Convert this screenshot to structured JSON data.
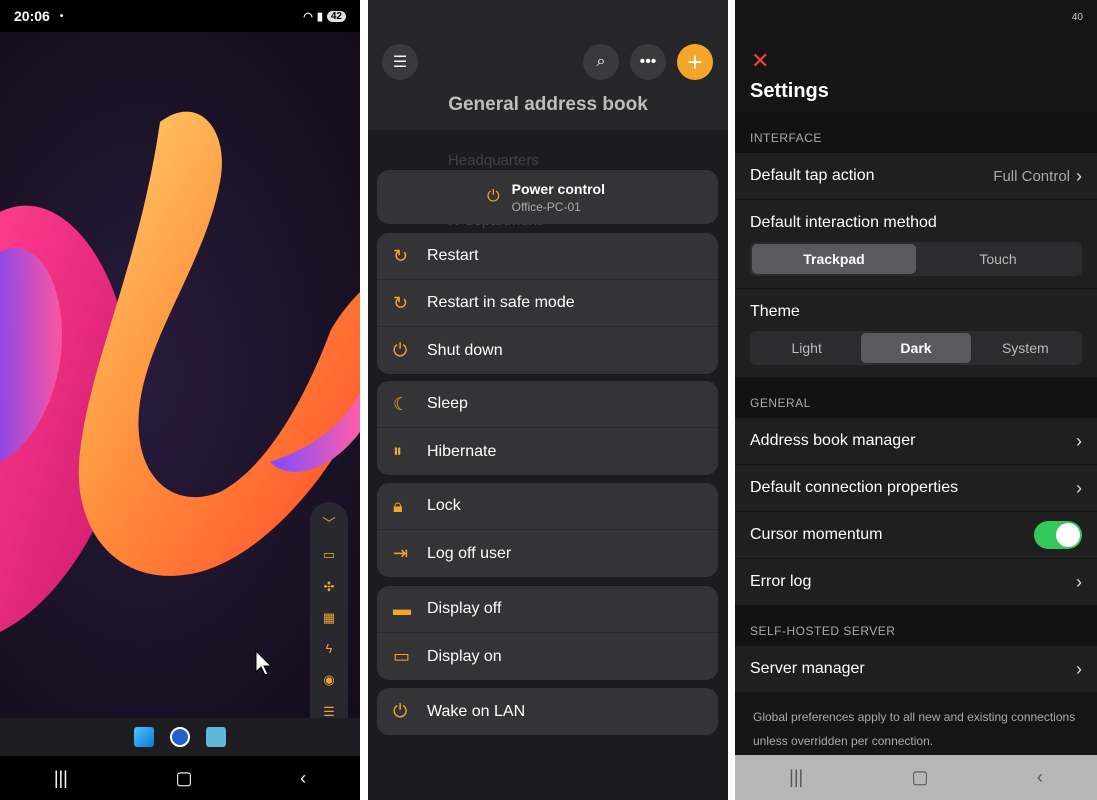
{
  "phone1": {
    "status": {
      "time": "20:06",
      "dot": "•",
      "battery": "42"
    },
    "toolbar_icons": [
      "chevron-down-icon",
      "monitor-icon",
      "collapse-icon",
      "keyboard-icon",
      "lightning-icon",
      "radio-icon",
      "sliders-icon",
      "close-icon"
    ]
  },
  "phone2": {
    "title": "General address book",
    "background_items": [
      "Headquarters",
      "IT department"
    ],
    "power_control": {
      "title": "Power control",
      "subtitle": "Office-PC-01"
    },
    "groups": [
      [
        "Restart",
        "Restart in safe mode",
        "Shut down"
      ],
      [
        "Sleep",
        "Hibernate"
      ],
      [
        "Lock",
        "Log off user"
      ],
      [
        "Display off",
        "Display on"
      ],
      [
        "Wake on LAN"
      ]
    ]
  },
  "phone3": {
    "status": "40",
    "title": "Settings",
    "interface_label": "INTERFACE",
    "default_tap_action": {
      "label": "Default tap action",
      "value": "Full Control"
    },
    "interaction_method": {
      "label": "Default interaction method",
      "options": [
        "Trackpad",
        "Touch"
      ],
      "selected": "Trackpad"
    },
    "theme": {
      "label": "Theme",
      "options": [
        "Light",
        "Dark",
        "System"
      ],
      "selected": "Dark"
    },
    "general_label": "GENERAL",
    "address_book_manager": "Address book manager",
    "default_connection_properties": "Default connection properties",
    "cursor_momentum": "Cursor momentum",
    "error_log": "Error log",
    "self_hosted_label": "SELF-HOSTED SERVER",
    "server_manager": "Server manager",
    "footnote": "Global preferences apply to all new and existing connections unless overridden per connection."
  },
  "colors": {
    "accent": "#f4a62a",
    "toggle_on": "#34c759",
    "close": "#ee4444"
  }
}
